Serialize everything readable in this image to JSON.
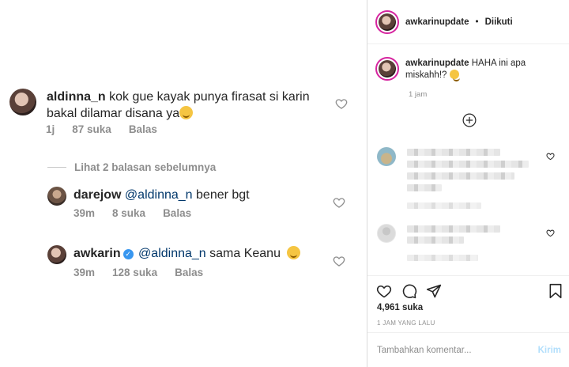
{
  "zoom_panel": {
    "comments": [
      {
        "username": "aldinna_n",
        "text": "kok gue kayak punya firasat si karin bakal dilamar disana ya",
        "time": "1j",
        "likes": "87 suka",
        "reply": "Balas"
      }
    ],
    "view_replies": "Lihat 2 balasan sebelumnya",
    "replies": [
      {
        "username": "darejow",
        "mention": "@aldinna_n",
        "text": "bener bgt",
        "time": "39m",
        "likes": "8 suka",
        "reply": "Balas"
      },
      {
        "username": "awkarin",
        "mention": "@aldinna_n",
        "text": "sama Keanu",
        "time": "39m",
        "likes": "128 suka",
        "reply": "Balas"
      }
    ]
  },
  "post_panel": {
    "header": {
      "username": "awkarinupdate",
      "separator": "•",
      "follow_status": "Diikuti"
    },
    "caption": {
      "username": "awkarinupdate",
      "text": "HAHA ini apa miskahh!?",
      "time": "1 jam"
    },
    "likes": "4,961 suka",
    "posted_ago": "1 JAM YANG LALU",
    "comment_input": {
      "placeholder": "Tambahkan komentar...",
      "submit_label": "Kirim"
    },
    "colors": {
      "link": "#00376b",
      "muted": "#8e8e8e",
      "submit_disabled": "#b2dffc",
      "verified": "#3897f0"
    }
  }
}
